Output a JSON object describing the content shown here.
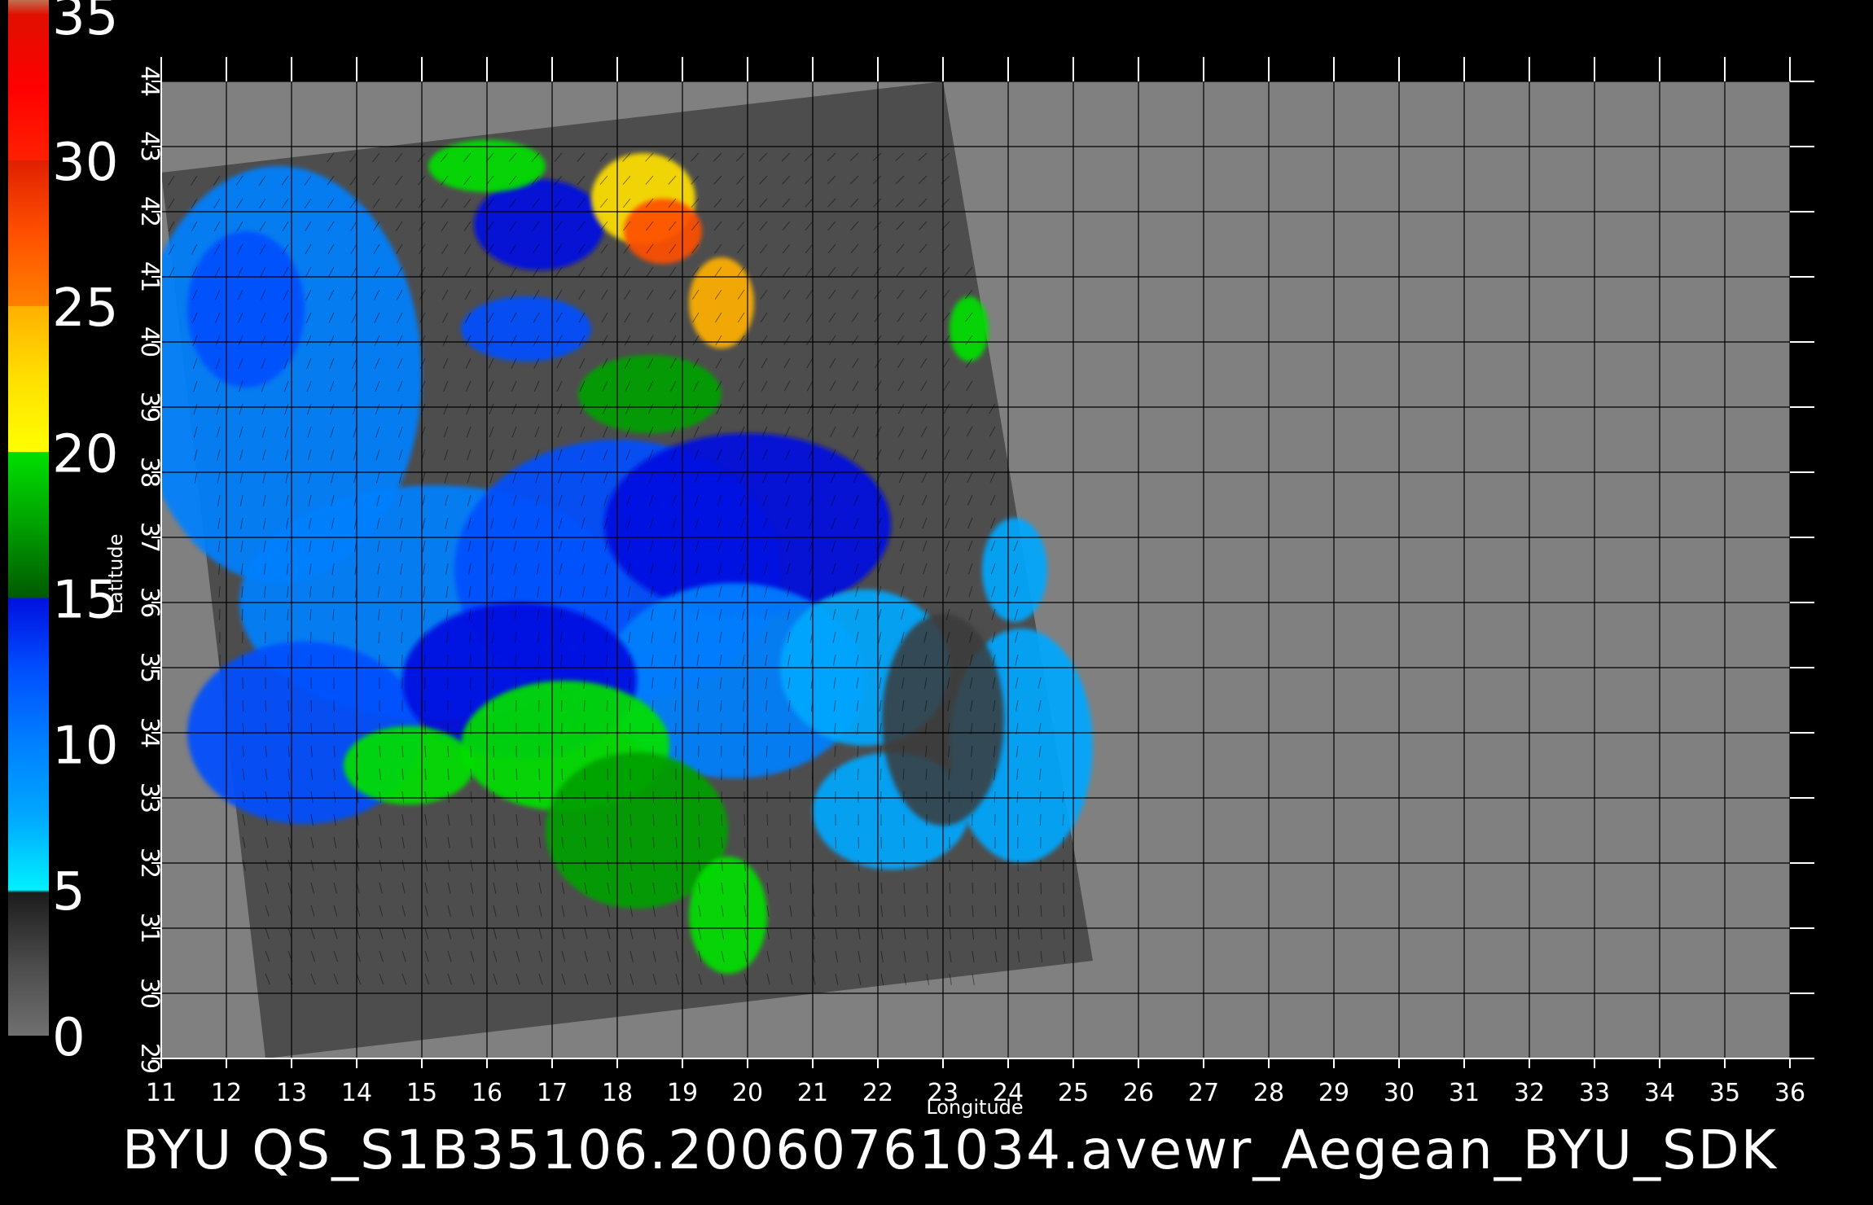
{
  "colorbar": {
    "labels": [
      "0",
      "5",
      "10",
      "15",
      "20",
      "25",
      "30",
      "35"
    ],
    "stops": [
      {
        "v": 0,
        "color": "#707070"
      },
      {
        "v": 2.5,
        "color": "#4a4a4a"
      },
      {
        "v": 4.9,
        "color": "#1c1c1c"
      },
      {
        "v": 5,
        "color": "#00f0ff"
      },
      {
        "v": 7.5,
        "color": "#00a8ff"
      },
      {
        "v": 10,
        "color": "#0080ff"
      },
      {
        "v": 12.5,
        "color": "#0050ff"
      },
      {
        "v": 15,
        "color": "#0010e0"
      },
      {
        "v": 15.01,
        "color": "#005a00"
      },
      {
        "v": 17.5,
        "color": "#00a000"
      },
      {
        "v": 20,
        "color": "#00e000"
      },
      {
        "v": 20.01,
        "color": "#ffff00"
      },
      {
        "v": 22.5,
        "color": "#ffe000"
      },
      {
        "v": 25,
        "color": "#ffb000"
      },
      {
        "v": 25.01,
        "color": "#ff8000"
      },
      {
        "v": 27.5,
        "color": "#ff5000"
      },
      {
        "v": 30,
        "color": "#e02000"
      },
      {
        "v": 30.01,
        "color": "#ff2000"
      },
      {
        "v": 32.5,
        "color": "#ff0000"
      },
      {
        "v": 35,
        "color": "#e01000"
      },
      {
        "v": 35.5,
        "color": "#c07050"
      }
    ]
  },
  "axes": {
    "x_ticks": [
      "11",
      "12",
      "13",
      "14",
      "15",
      "16",
      "17",
      "18",
      "19",
      "20",
      "21",
      "22",
      "23",
      "24",
      "25",
      "26",
      "27",
      "28",
      "29",
      "30",
      "31",
      "32",
      "33",
      "34",
      "35",
      "36"
    ],
    "y_ticks": [
      "29",
      "30",
      "31",
      "32",
      "33",
      "34",
      "35",
      "36",
      "37",
      "38",
      "39",
      "40",
      "41",
      "42",
      "43",
      "44"
    ],
    "x_title": "Longitude",
    "y_title": "Latitude",
    "x_range": [
      11,
      36
    ],
    "y_range": [
      29,
      44
    ]
  },
  "swath": {
    "corners_lonlat": [
      [
        11.0,
        42.6
      ],
      [
        23.0,
        44.0
      ],
      [
        25.3,
        30.5
      ],
      [
        12.6,
        29.0
      ]
    ]
  },
  "footer": {
    "title": "BYU  QS_S1B35106.20060761034.avewr_Aegean_BYU_SDK"
  },
  "colors": {
    "background": "#000000",
    "no_data": "#808080",
    "swath_land": "#4d4d4d",
    "grid": "#000000",
    "text": "#ffffff"
  }
}
